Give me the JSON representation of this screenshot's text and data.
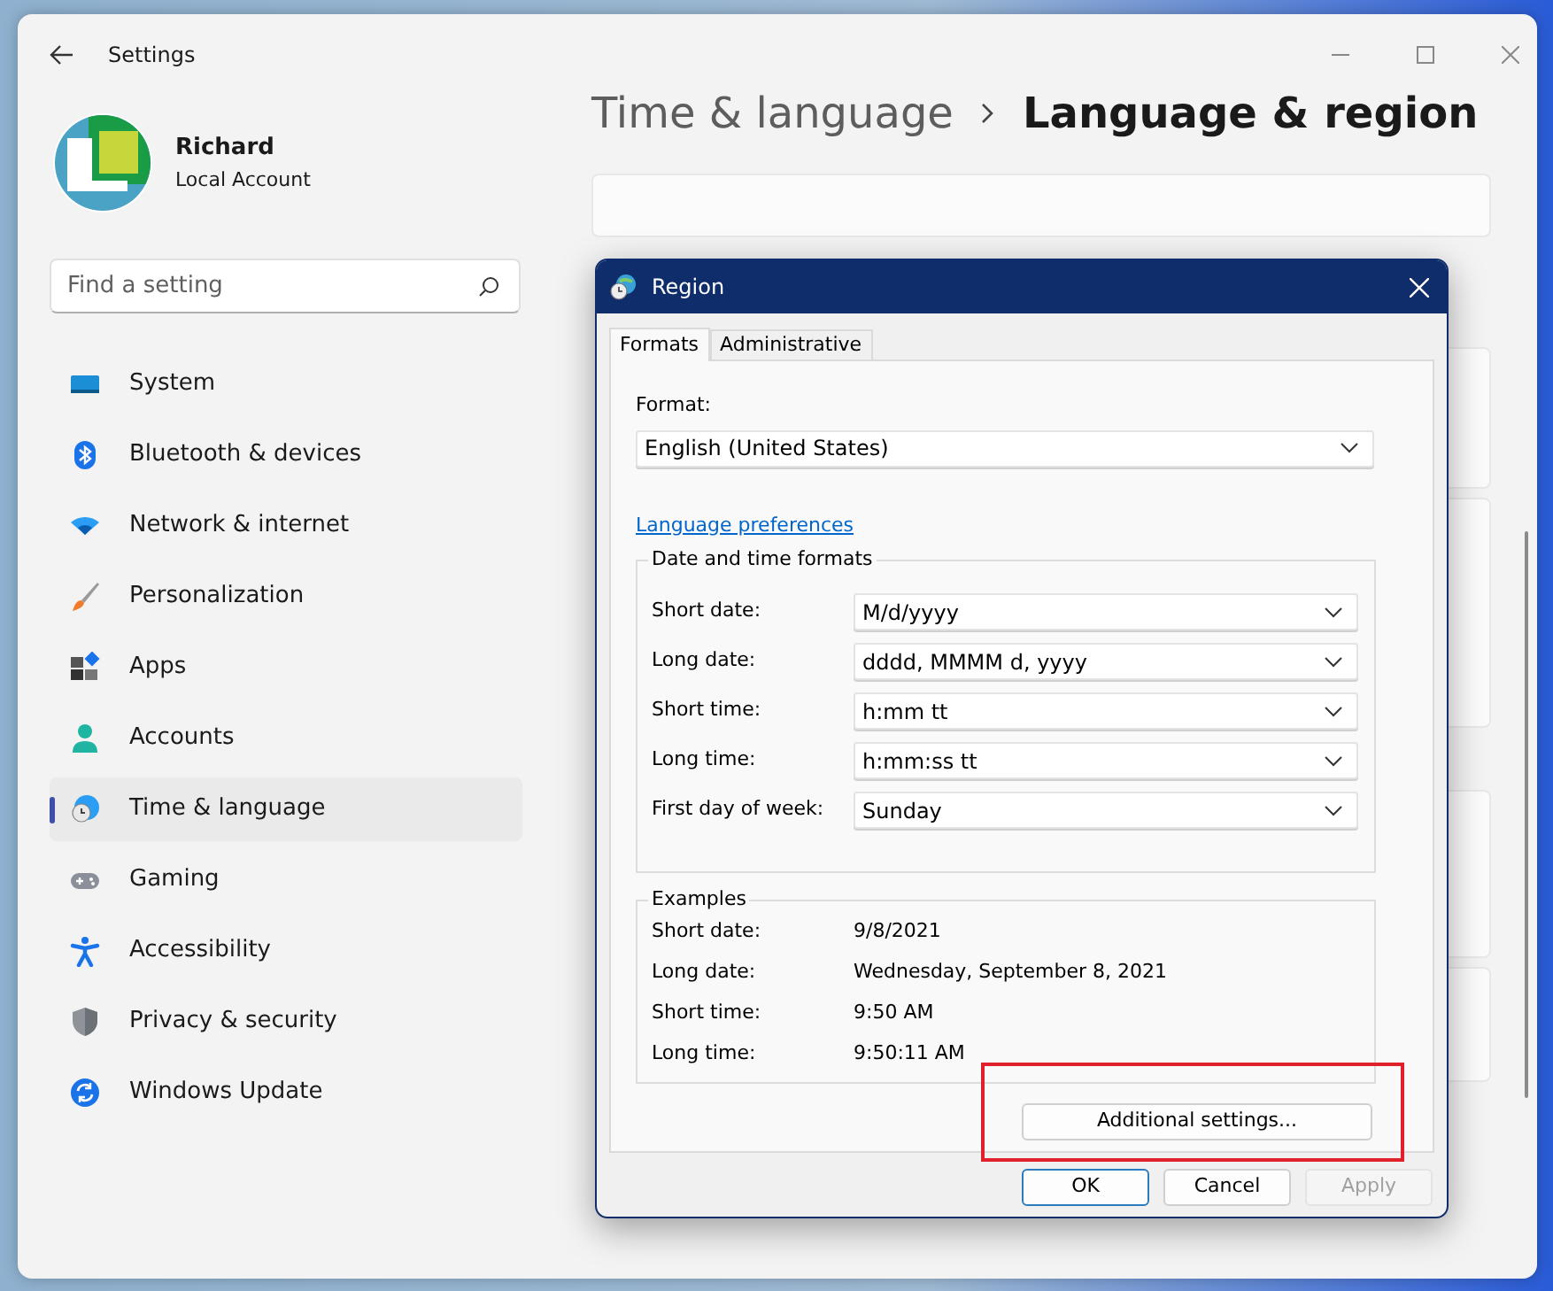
{
  "window": {
    "title": "Settings"
  },
  "account": {
    "name": "Richard",
    "type": "Local Account"
  },
  "search": {
    "placeholder": "Find a setting"
  },
  "nav": [
    {
      "label": "System",
      "kind": "system",
      "selected": false
    },
    {
      "label": "Bluetooth & devices",
      "kind": "bluetooth",
      "selected": false
    },
    {
      "label": "Network & internet",
      "kind": "network",
      "selected": false
    },
    {
      "label": "Personalization",
      "kind": "brush",
      "selected": false
    },
    {
      "label": "Apps",
      "kind": "apps",
      "selected": false
    },
    {
      "label": "Accounts",
      "kind": "person",
      "selected": false
    },
    {
      "label": "Time & language",
      "kind": "globe",
      "selected": true
    },
    {
      "label": "Gaming",
      "kind": "gamepad",
      "selected": false
    },
    {
      "label": "Accessibility",
      "kind": "accessibility",
      "selected": false
    },
    {
      "label": "Privacy & security",
      "kind": "shield",
      "selected": false
    },
    {
      "label": "Windows Update",
      "kind": "update",
      "selected": false
    }
  ],
  "breadcrumb": {
    "parent": "Time & language",
    "current": "Language & region"
  },
  "dialog": {
    "title": "Region",
    "tabs": [
      {
        "label": "Formats",
        "selected": true
      },
      {
        "label": "Administrative",
        "selected": false
      }
    ],
    "format": {
      "label": "Format:",
      "value": "English (United States)"
    },
    "link": "Language preferences",
    "formats_group": {
      "title": "Date and time formats",
      "rows": [
        {
          "label": "Short date:",
          "value": "M/d/yyyy"
        },
        {
          "label": "Long date:",
          "value": "dddd, MMMM d, yyyy"
        },
        {
          "label": "Short time:",
          "value": "h:mm tt"
        },
        {
          "label": "Long time:",
          "value": "h:mm:ss tt"
        },
        {
          "label": "First day of week:",
          "value": "Sunday"
        }
      ]
    },
    "examples": {
      "title": "Examples",
      "rows": [
        {
          "label": "Short date:",
          "value": "9/8/2021"
        },
        {
          "label": "Long date:",
          "value": "Wednesday, September 8, 2021"
        },
        {
          "label": "Short time:",
          "value": "9:50 AM"
        },
        {
          "label": "Long time:",
          "value": "9:50:11 AM"
        }
      ]
    },
    "additional_button": "Additional settings...",
    "buttons": [
      {
        "label": "OK",
        "default": true,
        "disabled": false
      },
      {
        "label": "Cancel",
        "default": false,
        "disabled": false
      },
      {
        "label": "Apply",
        "default": false,
        "disabled": true
      }
    ]
  }
}
